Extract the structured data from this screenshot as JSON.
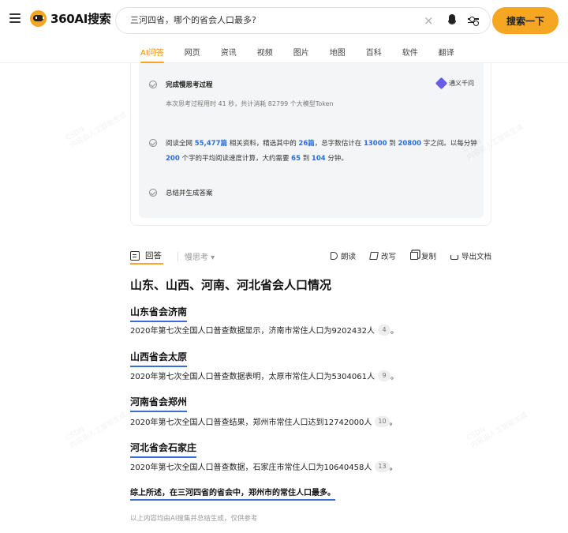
{
  "header": {
    "logo_text": "360AI搜索",
    "search_value": "三河四省，哪个的省会人口最多?",
    "clear_symbol": "×",
    "search_button": "搜索一下",
    "tabs": [
      "AI问答",
      "网页",
      "资讯",
      "视频",
      "图片",
      "地图",
      "百科",
      "软件",
      "翻译"
    ],
    "active_tab": "AI问答"
  },
  "thinking": {
    "step1_title": "完成慢思考过程",
    "step1_sub": "本次思考过程用时 41 秒，共计消耗 82799 个大模型Token",
    "model_name": "通义千问",
    "step2": {
      "p1": "阅读全网 ",
      "n1": "55,477篇",
      "p2": " 相关资料，精选其中的 ",
      "n2": "26篇",
      "p3": "，总字数估计在 ",
      "n3": "13000",
      "p4": " 到 ",
      "n4": "20800",
      "p5": " 字之间。以每分钟 ",
      "n5": "200",
      "p6": " 个字的平均阅读速度计算，大约需要 ",
      "n6": "65",
      "p7": " 到 ",
      "n7": "104",
      "p8": " 分钟。"
    },
    "step3_title": "总结并生成答案"
  },
  "answer_bar": {
    "answer_tab": "回答",
    "slow_think": "慢思考 ▾",
    "actions": [
      "朗读",
      "改写",
      "复制",
      "导出文档"
    ]
  },
  "answer": {
    "title": "山东、山西、河南、河北省会人口情况",
    "sections": [
      {
        "title": "山东省会济南",
        "body": "2020年第七次全国人口普查数据显示，济南市常住人口为9202432人",
        "ref": "4",
        "end": "。"
      },
      {
        "title": "山西省会太原",
        "body": "2020年第七次全国人口普查数据表明，太原市常住人口为5304061人",
        "ref": "9",
        "end": "。"
      },
      {
        "title": "河南省会郑州",
        "body": "2020年第七次全国人口普查结果，郑州市常住人口达到12742000人",
        "ref": "10",
        "end": "。"
      },
      {
        "title": "河北省会石家庄",
        "body": "2020年第七次全国人口普查数据，石家庄市常住人口为10640458人",
        "ref": "13",
        "end": "。"
      }
    ],
    "conclusion": "综上所述，在三河四省的省会中，郑州市的常住人口最多。",
    "disclaimer": "以上内容均由AI搜集并总结生成，仅供参考"
  },
  "watermark": {
    "line1": "CSDN",
    "line2": "内容由人工智能生成"
  },
  "colors": {
    "accent": "#f5a623",
    "link_blue": "#2a6fdb",
    "underline_blue": "#3b6cd4"
  }
}
